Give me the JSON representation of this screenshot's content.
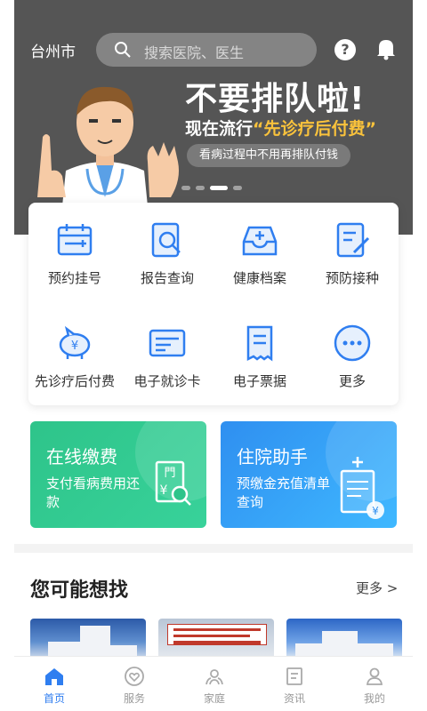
{
  "header": {
    "city": "台州市",
    "search_placeholder": "搜索医院、医生"
  },
  "banner": {
    "headline": "不要排队啦!",
    "subline_prefix": "现在流行",
    "subline_highlight": "“先诊疗后付费”",
    "pill_text": "看病过程中不用再排队付钱",
    "slide_count": 4,
    "active_slide": 3
  },
  "features": [
    {
      "label": "预约挂号",
      "icon": "calendar-icon"
    },
    {
      "label": "报告查询",
      "icon": "report-search-icon"
    },
    {
      "label": "健康档案",
      "icon": "health-tray-icon"
    },
    {
      "label": "预防接种",
      "icon": "vaccine-icon"
    },
    {
      "label": "先诊疗后付费",
      "icon": "piggy-bank-icon"
    },
    {
      "label": "电子就诊卡",
      "icon": "card-icon"
    },
    {
      "label": "电子票据",
      "icon": "receipt-icon"
    },
    {
      "label": "更多",
      "icon": "more-icon"
    }
  ],
  "promos": [
    {
      "title": "在线缴费",
      "desc": "支付看病费用还款",
      "icon": "bill-icon"
    },
    {
      "title": "住院助手",
      "desc": "预缴金充值清单查询",
      "icon": "clipboard-icon"
    }
  ],
  "section": {
    "title": "您可能想找",
    "more": "更多 >"
  },
  "bottom_nav": [
    {
      "label": "首页",
      "icon": "home-icon",
      "active": true
    },
    {
      "label": "服务",
      "icon": "service-heart-icon",
      "active": false
    },
    {
      "label": "家庭",
      "icon": "family-icon",
      "active": false
    },
    {
      "label": "资讯",
      "icon": "news-icon",
      "active": false
    },
    {
      "label": "我的",
      "icon": "profile-icon",
      "active": false
    }
  ],
  "colors": {
    "banner_bg": "#555555",
    "accent": "#2f7ef0",
    "highlight": "#f9c23c",
    "pay_green": "#2ec48a",
    "hospital_blue": "#2f8ff0"
  }
}
